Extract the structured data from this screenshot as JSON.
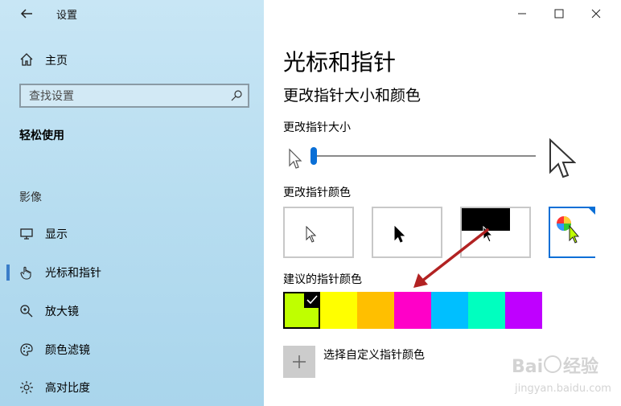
{
  "window": {
    "title": "设置"
  },
  "sidebar": {
    "home_label": "主页",
    "search_placeholder": "查找设置",
    "section_heading": "轻松使用",
    "group_heading": "影像",
    "items": [
      {
        "label": "显示",
        "icon": "monitor-icon"
      },
      {
        "label": "光标和指针",
        "icon": "hand-pointer-icon",
        "active": true
      },
      {
        "label": "放大镜",
        "icon": "magnifier-icon"
      },
      {
        "label": "颜色滤镜",
        "icon": "palette-icon"
      },
      {
        "label": "高对比度",
        "icon": "sun-icon"
      }
    ]
  },
  "main": {
    "page_title": "光标和指针",
    "sub_title": "更改指针大小和颜色",
    "size_label": "更改指针大小",
    "size_level": 0,
    "color_label": "更改指针颜色",
    "color_options": [
      "white",
      "black",
      "inverted",
      "custom"
    ],
    "selected_color_option": "custom",
    "suggested_label": "建议的指针颜色",
    "suggested_colors": [
      "#bfff00",
      "#ffff00",
      "#ffbf00",
      "#ff00c8",
      "#00bfff",
      "#00ffbf",
      "#bf00ff"
    ],
    "selected_suggested_index": 0,
    "custom_color_label": "选择自定义指针颜色"
  },
  "watermark": {
    "brand": "Baidu 经验",
    "url": "jingyan.baidu.com"
  },
  "colors": {
    "accent": "#0a6fd6",
    "sidebar_bg": "#b7ddf0",
    "annotation": "#b22222"
  }
}
